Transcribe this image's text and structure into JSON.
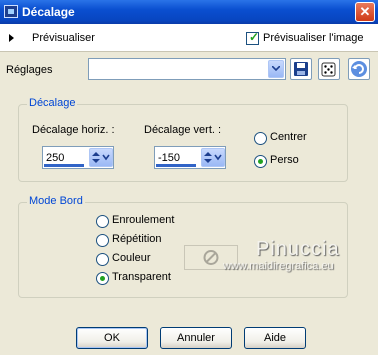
{
  "window": {
    "title": "Décalage",
    "close_glyph": "✕"
  },
  "preview": {
    "label": "Prévisualiser",
    "checkbox_label": "Prévisualiser l'image",
    "checked": true
  },
  "settings": {
    "label": "Réglages",
    "preset_value": ""
  },
  "offset_group": {
    "title": "Décalage",
    "horiz_label": "Décalage horiz. :",
    "vert_label": "Décalage vert. :",
    "horiz_value": "250",
    "vert_value": "-150",
    "radio_center": "Centrer",
    "radio_custom": "Perso",
    "selected": "Perso"
  },
  "edge_group": {
    "title": "Mode Bord",
    "options": [
      "Enroulement",
      "Répétition",
      "Couleur",
      "Transparent"
    ],
    "selected": "Transparent"
  },
  "watermark": {
    "name": "Pinuccia",
    "url": "www.maidiregrafica.eu"
  },
  "buttons": {
    "ok": "OK",
    "cancel": "Annuler",
    "help": "Aide"
  },
  "colors": {
    "titlebar": "#0a4fd0",
    "group_title": "#0046d5",
    "check_green": "#21a121"
  }
}
